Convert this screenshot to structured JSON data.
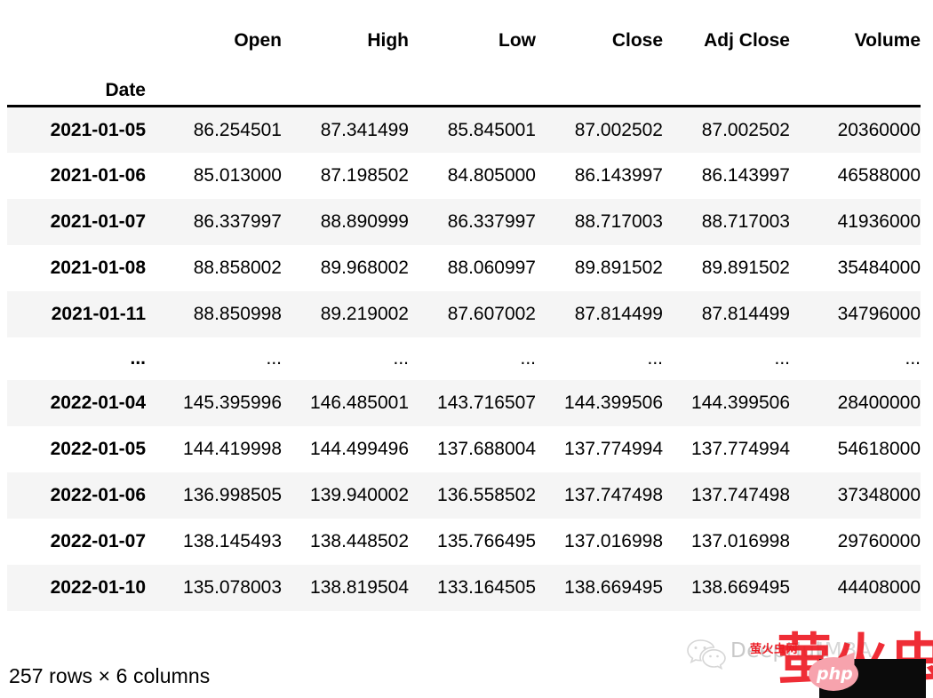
{
  "table": {
    "index_name": "Date",
    "columns": [
      "Open",
      "High",
      "Low",
      "Close",
      "Adj Close",
      "Volume"
    ],
    "rows": [
      {
        "date": "2021-01-05",
        "cells": [
          "86.254501",
          "87.341499",
          "85.845001",
          "87.002502",
          "87.002502",
          "20360000"
        ]
      },
      {
        "date": "2021-01-06",
        "cells": [
          "85.013000",
          "87.198502",
          "84.805000",
          "86.143997",
          "86.143997",
          "46588000"
        ]
      },
      {
        "date": "2021-01-07",
        "cells": [
          "86.337997",
          "88.890999",
          "86.337997",
          "88.717003",
          "88.717003",
          "41936000"
        ]
      },
      {
        "date": "2021-01-08",
        "cells": [
          "88.858002",
          "89.968002",
          "88.060997",
          "89.891502",
          "89.891502",
          "35484000"
        ]
      },
      {
        "date": "2021-01-11",
        "cells": [
          "88.850998",
          "89.219002",
          "87.607002",
          "87.814499",
          "87.814499",
          "34796000"
        ]
      },
      {
        "date": "...",
        "cells": [
          "...",
          "...",
          "...",
          "...",
          "...",
          "..."
        ]
      },
      {
        "date": "2022-01-04",
        "cells": [
          "145.395996",
          "146.485001",
          "143.716507",
          "144.399506",
          "144.399506",
          "28400000"
        ]
      },
      {
        "date": "2022-01-05",
        "cells": [
          "144.419998",
          "144.499496",
          "137.688004",
          "137.774994",
          "137.774994",
          "54618000"
        ]
      },
      {
        "date": "2022-01-06",
        "cells": [
          "136.998505",
          "139.940002",
          "136.558502",
          "137.747498",
          "137.747498",
          "37348000"
        ]
      },
      {
        "date": "2022-01-07",
        "cells": [
          "138.145493",
          "138.448502",
          "135.766495",
          "137.016998",
          "137.016998",
          "29760000"
        ]
      },
      {
        "date": "2022-01-10",
        "cells": [
          "135.078003",
          "138.819504",
          "133.164505",
          "138.669495",
          "138.669495",
          "44408000"
        ]
      }
    ],
    "shape_text": "257 rows × 6 columns"
  },
  "watermark": {
    "wechat_icon": "wechat-icon",
    "brand": "DeepHub",
    "brand_suffix": "IMBA",
    "chinese_text": "萤火虫",
    "php_badge": "php",
    "box_text": "萤火虫网"
  },
  "colors": {
    "stripe": "#f5f5f5",
    "text": "#000000",
    "rule": "#000000",
    "watermark_red": "#ee1c25",
    "watermark_gray": "#c9c9c9"
  }
}
